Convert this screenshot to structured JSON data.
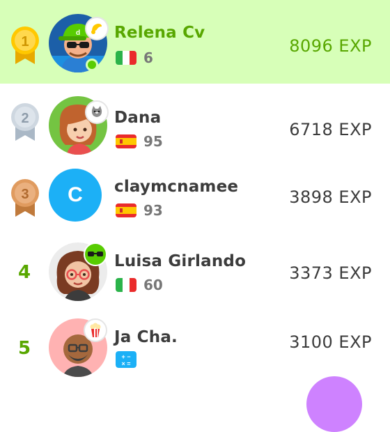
{
  "leaderboard": {
    "rows": [
      {
        "rank": "1",
        "name": "Relena Cv",
        "streak": "6",
        "exp": "8096 EXP",
        "flag": "italy-flag",
        "badge": "horn-icon",
        "online": true
      },
      {
        "rank": "2",
        "name": "Dana",
        "streak": "95",
        "exp": "6718 EXP",
        "flag": "spain-flag",
        "badge": "cat-icon"
      },
      {
        "rank": "3",
        "name": "claymcnamee",
        "streak": "93",
        "exp": "3898 EXP",
        "flag": "spain-flag",
        "avatar_letter": "C"
      },
      {
        "rank": "4",
        "name": "Luisa Girlando",
        "streak": "60",
        "exp": "3373 EXP",
        "flag": "italy-flag",
        "badge": "cool-owl-icon"
      },
      {
        "rank": "5",
        "name": "Ja Cha.",
        "streak": "",
        "exp": "3100 EXP",
        "flag": "math-icon",
        "badge": "popcorn-icon"
      }
    ]
  },
  "colors": {
    "highlight_bg": "#d7ffb8",
    "accent_green": "#58a700",
    "gold": "#ffc800",
    "silver": "#ced7e0",
    "bronze": "#e09b5f",
    "blue_avatar": "#1cb0f6"
  }
}
